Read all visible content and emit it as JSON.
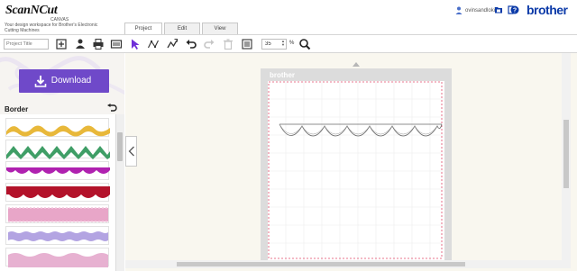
{
  "app": {
    "logo_text": "ScanNCut",
    "logo_subtext": "CANVAS",
    "tagline": "Your design workspace for Brother's Electronic Cutting Machines",
    "brand": "brother"
  },
  "tabs": [
    {
      "label": "Project",
      "active": true
    },
    {
      "label": "Edit",
      "active": false
    },
    {
      "label": "View",
      "active": false
    }
  ],
  "user": {
    "name": "ovinsandloki"
  },
  "header_icons": [
    "user-icon",
    "folder-icon",
    "logout-icon",
    "help-icon"
  ],
  "toolbar": {
    "title_placeholder": "Project Title",
    "zoom_value": "35",
    "zoom_unit": "%",
    "tools": [
      "new-project-icon",
      "person-upload-icon",
      "print-icon",
      "machine-transfer-icon",
      "select-arrow-icon",
      "node-edit-icon",
      "undo-icon",
      "redo-icon",
      "delete-icon",
      "layers-icon",
      "zoom-icon"
    ]
  },
  "sidebar": {
    "download_label": "Download",
    "section_title": "Border",
    "patterns": [
      {
        "name": "yellow-wave-border",
        "color": "#e8b83a"
      },
      {
        "name": "green-zigzag-border",
        "color": "#3f9e66"
      },
      {
        "name": "purple-scallop-border",
        "color": "#b022b0"
      },
      {
        "name": "dark-red-scallop-border",
        "color": "#b3122a"
      },
      {
        "name": "pink-stitched-border",
        "color": "#e8a6c8"
      },
      {
        "name": "lavender-wave-border",
        "color": "#b3a4e2"
      },
      {
        "name": "pink-wave-border",
        "color": "#e7b1d1"
      }
    ]
  },
  "canvas": {
    "mat_brand": "brother",
    "accent_color": "#6f49c9",
    "cut_line_color": "#e24a6a"
  }
}
